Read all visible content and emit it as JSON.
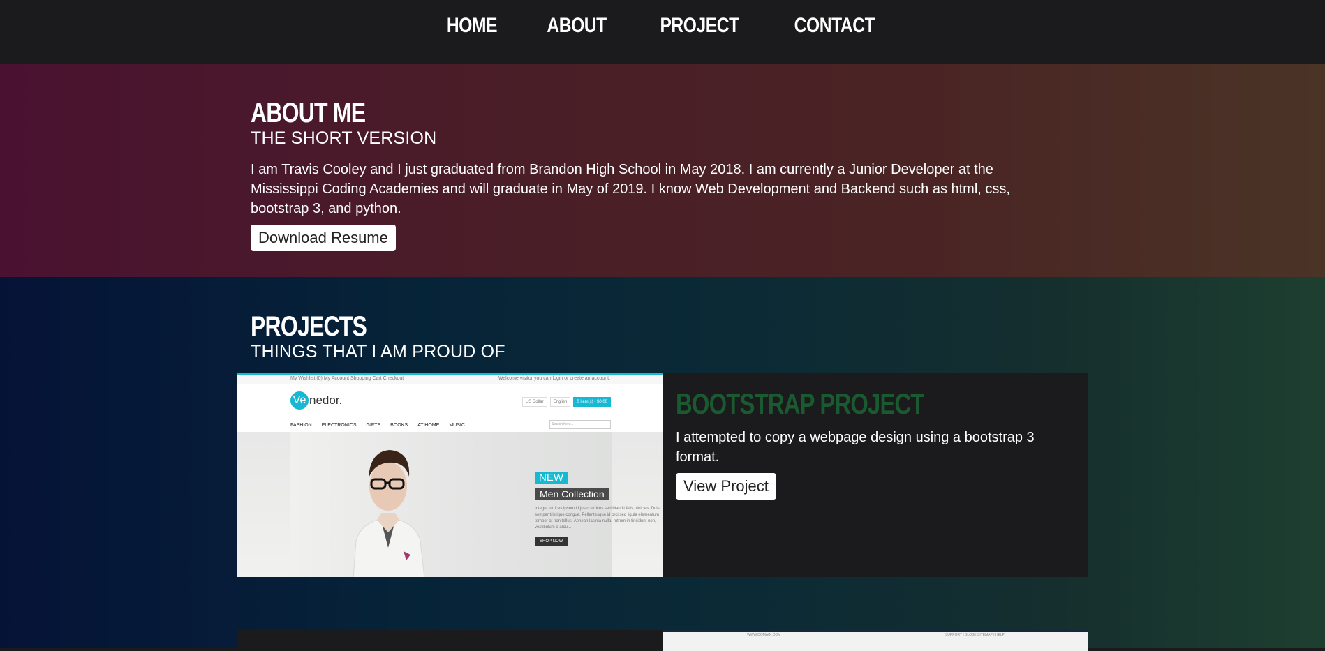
{
  "nav": {
    "items": [
      "HOME",
      "ABOUT",
      "PROJECT",
      "CONTACT"
    ]
  },
  "about": {
    "title": "ABOUT ME",
    "subtitle": "THE SHORT VERSION",
    "text": "I am Travis Cooley and I just graduated from Brandon High School in May 2018. I am currently a Junior Developer at the Mississippi Coding Academies and will graduate in May of 2019. I know Web Development and Backend such as html, css, bootstrap 3, and python.",
    "button": "Download Resume"
  },
  "projects": {
    "title": "PROJECTS",
    "subtitle": "THINGS THAT I AM PROUD OF",
    "cards": [
      {
        "title": "BOOTSTRAP PROJECT",
        "description": "I attempted to copy a webpage design using a bootstrap 3 format.",
        "button": "View Project",
        "preview": {
          "topbar_left": "My Wishlist (0)   My Account   Shopping Cart   Checkout",
          "topbar_right": "Welcome visitor you can login or create an account.",
          "logo_letters": "Ve",
          "logo_rest": "nedor.",
          "currency": "US Dollar",
          "language": "English",
          "cart": "0 item(s) - $0.00",
          "menu": [
            "FASHION",
            "ELECTRONICS",
            "GIFTS",
            "BOOKS",
            "AT HOME",
            "MUSIC"
          ],
          "search_placeholder": "Search here...",
          "badge_new": "NEW",
          "collection": "Men Collection",
          "blurb": "Integer ultrices ipsum id justo ultrices sed blandit felis ultricies. Duis semper tristique congue. Pellentesque id orci sed ligula elementum tempor at non tellus. Aenean lacinia nulla, rutrum in tincidunt non, vestibulum a arcu...",
          "shop_button": "SHOP NOW"
        }
      },
      {
        "preview": {
          "topbar_left": "WWW.DOMAIN.COM",
          "topbar_right": "SUPPORT | BLOG | SITEMAP | HELP"
        }
      }
    ]
  }
}
